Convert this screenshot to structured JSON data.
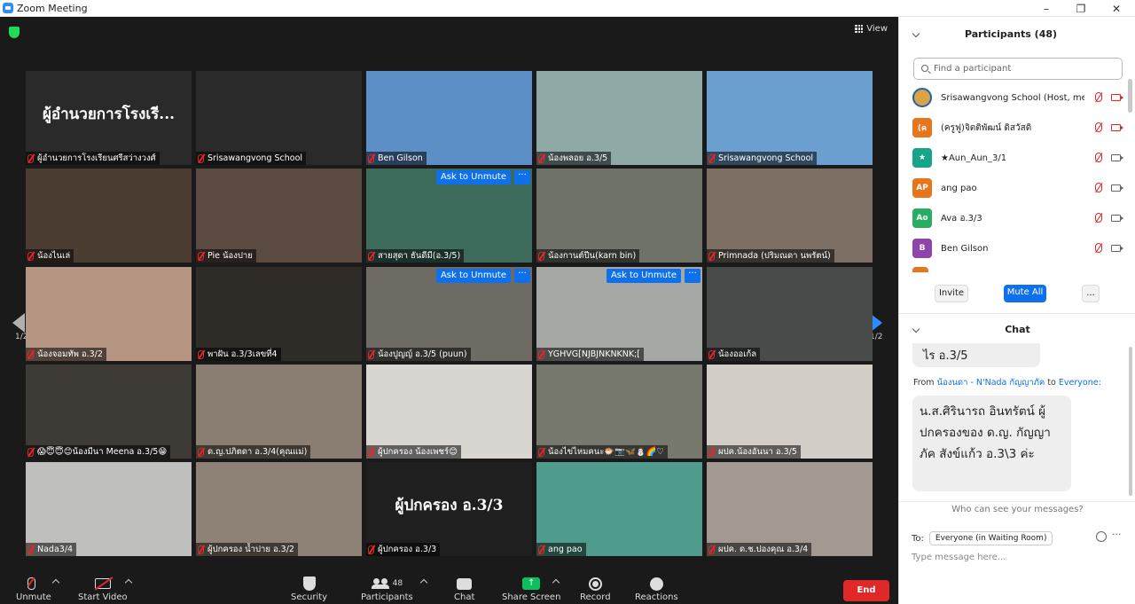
{
  "window": {
    "title": "Zoom Meeting",
    "min": "–",
    "max": "❐",
    "close": "✕"
  },
  "view_label": "View",
  "page_indicator": "1/2",
  "tiles": [
    {
      "name": "ผู้อำนวยการโรงเรียนศรีสว่างวงศ์",
      "big": "ผู้อำนวยการโรงเรี...",
      "bg": "#2a2a2a"
    },
    {
      "name": "Srisawangvong School",
      "bg": "#2a2a2a"
    },
    {
      "name": "Ben Gilson",
      "bg": "#5d8fc7"
    },
    {
      "name": "น้องพลอย อ.3/5",
      "bg": "#8fa9a6"
    },
    {
      "name": "Srisawangvong School",
      "bg": "#6b9fd0"
    },
    {
      "name": "น้องไนเล่",
      "bg": "#4c3d33"
    },
    {
      "name": "Pie น้องปาย",
      "bg": "#5a4a42"
    },
    {
      "name": "สายสุดา ธันดีมี(อ.3/5)",
      "bg": "#3d6b5c",
      "ask": "Ask to Unmute"
    },
    {
      "name": "น้องกานต์ปีน(karn bin)",
      "bg": "#6e7268"
    },
    {
      "name": "Primnada (ปริมณดา นพรัตน์)",
      "bg": "#7d6f63"
    },
    {
      "name": "น้องจอมทัพ อ.3/2",
      "bg": "#b69682"
    },
    {
      "name": "พาฝัน อ.3/3เลขที่4",
      "bg": "#2f2b26"
    },
    {
      "name": "น้องปูญญ์ อ.3/5 (puun)",
      "bg": "#6e6a64",
      "ask": "Ask to Unmute"
    },
    {
      "name": "YGHVG[NJBJNKNKNK;[",
      "bg": "#a6a8a5",
      "ask": "Ask to Unmute"
    },
    {
      "name": "น้องออเก้ล",
      "bg": "#494c4b"
    },
    {
      "name": "😱😇😇😊น้องมีนา Meena อ.3/5😁",
      "bg": "#3e3b36"
    },
    {
      "name": "ด.ญ.ปภิตดา อ.3/4(คุณแม่)",
      "bg": "#8a7e72"
    },
    {
      "name": "ผู้ปกครอง น้องเพชร์😊",
      "bg": "#d9d6d2"
    },
    {
      "name": "น้องไข่ไหมคนะ🐡📷🦋⛄🌈♡",
      "bg": "#77796f"
    },
    {
      "name": "ผปค.น้องอันนา อ.3/5",
      "bg": "#d2cdc6"
    },
    {
      "name": "Nada3/4",
      "bg": "#bfbfbd"
    },
    {
      "name": "ผู้ปกครอง น้ำปาย อ.3/2",
      "bg": "#8e8276"
    },
    {
      "name": "ผู้ปกครอง อ.3/3",
      "big": "ผู้ปกครอง อ.3/3",
      "bg": "#1f1f1f",
      "active": "yes"
    },
    {
      "name": "ang pao",
      "bg": "#4f9b8c"
    },
    {
      "name": "ผปค. ด.ช.ปองคุณ อ.3/4",
      "bg": "#a29a92"
    }
  ],
  "ask_more": "···",
  "toolbar": {
    "unmute": "Unmute",
    "start_video": "Start Video",
    "security": "Security",
    "participants": "Participants",
    "participants_count": "48",
    "chat": "Chat",
    "share_screen": "Share Screen",
    "record": "Record",
    "reactions": "Reactions",
    "end": "End"
  },
  "panel": {
    "participants_title": "Participants (48)",
    "search_placeholder": "Find a participant",
    "participants": [
      {
        "name": "Srisawangvong School (Host, me)",
        "initials": "",
        "color": "#d9a441",
        "cam_off": "yes"
      },
      {
        "name": "(ครูฟู)จิตติพัฒน์ ดิสวัสดิ",
        "initials": "(ค",
        "color": "#e8751a",
        "cam_off": "yes"
      },
      {
        "name": "★Aun_Aun_3/1",
        "initials": "★",
        "color": "#17a589",
        "cam_off": "no"
      },
      {
        "name": "ang pao",
        "initials": "AP",
        "color": "#e8751a",
        "cam_off": "no"
      },
      {
        "name": "Ava อ.3/3",
        "initials": "Ao",
        "color": "#27ae60",
        "cam_off": "no"
      },
      {
        "name": "Ben Gilson",
        "initials": "B",
        "color": "#8e44ad",
        "cam_off": "no"
      }
    ],
    "invite": "Invite",
    "mute_all": "Mute All",
    "more": "...",
    "chat_title": "Chat",
    "chat_prev": "ไร อ.3/5",
    "chat_from": "From",
    "chat_sender": "น้องนดา - N'Nada กัญญาภัค",
    "chat_to_word": "to",
    "chat_to": "Everyone:",
    "chat_msg": "น.ส.ศิรินารถ อินทรัตน์ ผู้ปกครองของ ด.ญ. กัญญาภัค สังข์แก้ว อ.3\\3 ค่ะ",
    "who_can_see": "Who can see your messages?",
    "to_label": "To:",
    "to_value": "Everyone (in Waiting Room)",
    "type_placeholder": "Type message here..."
  },
  "colors": {
    "accent": "#0e71eb",
    "end": "#e02828",
    "mute_red": "#e02828",
    "share_green": "#0cc15d",
    "active_border": "#e6f07a"
  }
}
